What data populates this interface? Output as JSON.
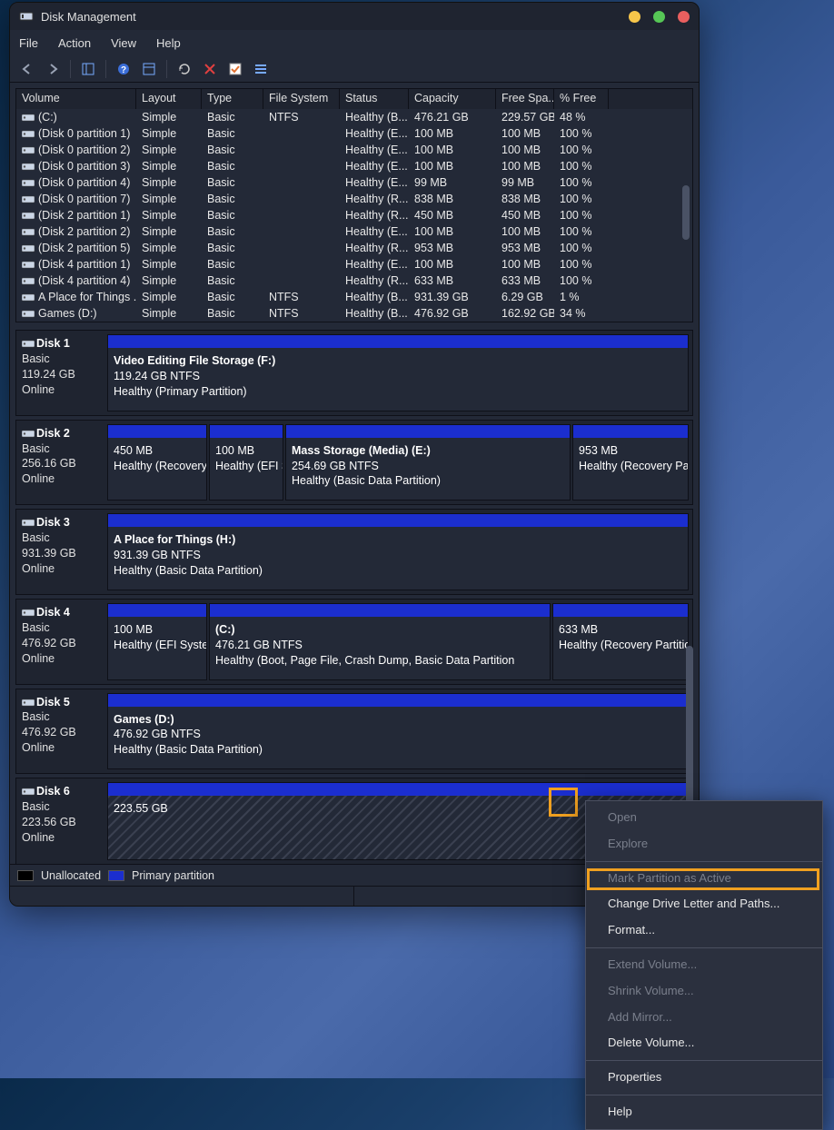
{
  "title": "Disk Management",
  "menu": {
    "file": "File",
    "action": "Action",
    "view": "View",
    "help": "Help"
  },
  "columns": [
    "Volume",
    "Layout",
    "Type",
    "File System",
    "Status",
    "Capacity",
    "Free Spa...",
    "% Free"
  ],
  "volumes": [
    {
      "v": "(C:)",
      "l": "Simple",
      "t": "Basic",
      "fs": "NTFS",
      "st": "Healthy (B...",
      "cap": "476.21 GB",
      "free": "229.57 GB",
      "pct": "48 %"
    },
    {
      "v": "(Disk 0 partition 1)",
      "l": "Simple",
      "t": "Basic",
      "fs": "",
      "st": "Healthy (E...",
      "cap": "100 MB",
      "free": "100 MB",
      "pct": "100 %"
    },
    {
      "v": "(Disk 0 partition 2)",
      "l": "Simple",
      "t": "Basic",
      "fs": "",
      "st": "Healthy (E...",
      "cap": "100 MB",
      "free": "100 MB",
      "pct": "100 %"
    },
    {
      "v": "(Disk 0 partition 3)",
      "l": "Simple",
      "t": "Basic",
      "fs": "",
      "st": "Healthy (E...",
      "cap": "100 MB",
      "free": "100 MB",
      "pct": "100 %"
    },
    {
      "v": "(Disk 0 partition 4)",
      "l": "Simple",
      "t": "Basic",
      "fs": "",
      "st": "Healthy (E...",
      "cap": "99 MB",
      "free": "99 MB",
      "pct": "100 %"
    },
    {
      "v": "(Disk 0 partition 7)",
      "l": "Simple",
      "t": "Basic",
      "fs": "",
      "st": "Healthy (R...",
      "cap": "838 MB",
      "free": "838 MB",
      "pct": "100 %"
    },
    {
      "v": "(Disk 2 partition 1)",
      "l": "Simple",
      "t": "Basic",
      "fs": "",
      "st": "Healthy (R...",
      "cap": "450 MB",
      "free": "450 MB",
      "pct": "100 %"
    },
    {
      "v": "(Disk 2 partition 2)",
      "l": "Simple",
      "t": "Basic",
      "fs": "",
      "st": "Healthy (E...",
      "cap": "100 MB",
      "free": "100 MB",
      "pct": "100 %"
    },
    {
      "v": "(Disk 2 partition 5)",
      "l": "Simple",
      "t": "Basic",
      "fs": "",
      "st": "Healthy (R...",
      "cap": "953 MB",
      "free": "953 MB",
      "pct": "100 %"
    },
    {
      "v": "(Disk 4 partition 1)",
      "l": "Simple",
      "t": "Basic",
      "fs": "",
      "st": "Healthy (E...",
      "cap": "100 MB",
      "free": "100 MB",
      "pct": "100 %"
    },
    {
      "v": "(Disk 4 partition 4)",
      "l": "Simple",
      "t": "Basic",
      "fs": "",
      "st": "Healthy (R...",
      "cap": "633 MB",
      "free": "633 MB",
      "pct": "100 %"
    },
    {
      "v": "A Place for Things ...",
      "l": "Simple",
      "t": "Basic",
      "fs": "NTFS",
      "st": "Healthy (B...",
      "cap": "931.39 GB",
      "free": "6.29 GB",
      "pct": "1 %"
    },
    {
      "v": "Games (D:)",
      "l": "Simple",
      "t": "Basic",
      "fs": "NTFS",
      "st": "Healthy (B...",
      "cap": "476.92 GB",
      "free": "162.92 GB",
      "pct": "34 %"
    }
  ],
  "disks": [
    {
      "name": "Disk 1",
      "type": "Basic",
      "cap": "119.24 GB",
      "status": "Online",
      "parts": [
        {
          "title": "Video Editing File Storage  (F:)",
          "sz": "119.24 GB NTFS",
          "health": "Healthy (Primary Partition)",
          "flex": "1"
        }
      ]
    },
    {
      "name": "Disk 2",
      "type": "Basic",
      "cap": "256.16 GB",
      "status": "Online",
      "parts": [
        {
          "title": "",
          "sz": "450 MB",
          "health": "Healthy (Recovery",
          "flex": "0 0 110px"
        },
        {
          "title": "",
          "sz": "100 MB",
          "health": "Healthy (EFI S",
          "flex": "0 0 82px"
        },
        {
          "title": "Mass Storage (Media)  (E:)",
          "sz": "254.69 GB NTFS",
          "health": "Healthy (Basic Data Partition)",
          "flex": "1"
        },
        {
          "title": "",
          "sz": "953 MB",
          "health": "Healthy (Recovery Par",
          "flex": "0 0 128px"
        }
      ]
    },
    {
      "name": "Disk 3",
      "type": "Basic",
      "cap": "931.39 GB",
      "status": "Online",
      "parts": [
        {
          "title": "A Place for Things  (H:)",
          "sz": "931.39 GB NTFS",
          "health": "Healthy (Basic Data Partition)",
          "flex": "1"
        }
      ]
    },
    {
      "name": "Disk 4",
      "type": "Basic",
      "cap": "476.92 GB",
      "status": "Online",
      "parts": [
        {
          "title": "",
          "sz": "100 MB",
          "health": "Healthy (EFI Syster",
          "flex": "0 0 110px"
        },
        {
          "title": "(C:)",
          "sz": "476.21 GB NTFS",
          "health": "Healthy (Boot, Page File, Crash Dump, Basic Data Partition",
          "flex": "1"
        },
        {
          "title": "",
          "sz": "633 MB",
          "health": "Healthy (Recovery Partition",
          "flex": "0 0 150px"
        }
      ]
    },
    {
      "name": "Disk 5",
      "type": "Basic",
      "cap": "476.92 GB",
      "status": "Online",
      "parts": [
        {
          "title": "Games  (D:)",
          "sz": "476.92 GB NTFS",
          "health": "Healthy (Basic Data Partition)",
          "flex": "1"
        }
      ]
    },
    {
      "name": "Disk 6",
      "type": "Basic",
      "cap": "223.56 GB",
      "status": "Online",
      "parts": [
        {
          "title": "",
          "sz": "223.55 GB",
          "health": "",
          "flex": "1",
          "hatched": true
        }
      ]
    }
  ],
  "legend": {
    "unalloc": "Unallocated",
    "primary": "Primary partition"
  },
  "context": [
    {
      "label": "Open",
      "enabled": false
    },
    {
      "label": "Explore",
      "enabled": false
    },
    {
      "sep": true
    },
    {
      "label": "Mark Partition as Active",
      "enabled": false
    },
    {
      "label": "Change Drive Letter and Paths...",
      "enabled": true,
      "hilite": true
    },
    {
      "label": "Format...",
      "enabled": true
    },
    {
      "sep": true
    },
    {
      "label": "Extend Volume...",
      "enabled": false
    },
    {
      "label": "Shrink Volume...",
      "enabled": false
    },
    {
      "label": "Add Mirror...",
      "enabled": false
    },
    {
      "label": "Delete Volume...",
      "enabled": true
    },
    {
      "sep": true
    },
    {
      "label": "Properties",
      "enabled": true
    },
    {
      "sep": true
    },
    {
      "label": "Help",
      "enabled": true
    }
  ]
}
